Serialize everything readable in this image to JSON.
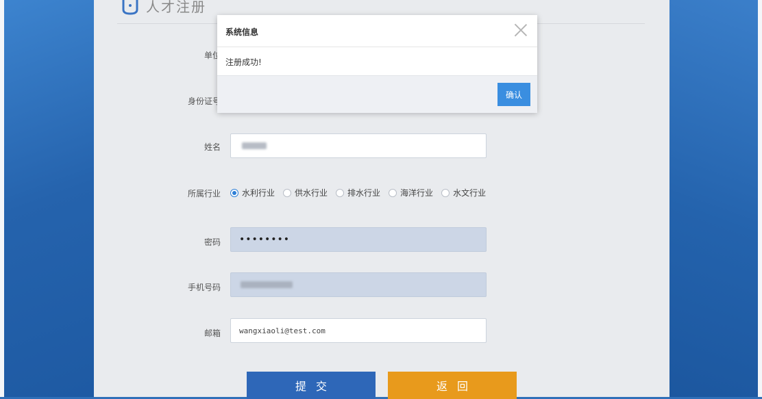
{
  "header": {
    "title": "人才注册"
  },
  "form": {
    "unit_label": "单位",
    "id_label": "身份证号",
    "name_label": "姓名",
    "industry_label": "所属行业",
    "industries": [
      {
        "label": "水利行业",
        "checked": true
      },
      {
        "label": "供水行业",
        "checked": false
      },
      {
        "label": "排水行业",
        "checked": false
      },
      {
        "label": "海洋行业",
        "checked": false
      },
      {
        "label": "水文行业",
        "checked": false
      }
    ],
    "password_label": "密码",
    "password_value": "••••••••",
    "phone_label": "手机号码",
    "email_label": "邮箱",
    "email_value": "wangxiaoli@test.com",
    "submit_label": "提交",
    "back_label": "返回"
  },
  "modal": {
    "title": "系统信息",
    "message": "注册成功!",
    "ok_label": "确认"
  },
  "colors": {
    "accent": "#2e7fd6",
    "submit": "#2e67b8",
    "back": "#e89a1c",
    "ok": "#3a8ee0"
  }
}
